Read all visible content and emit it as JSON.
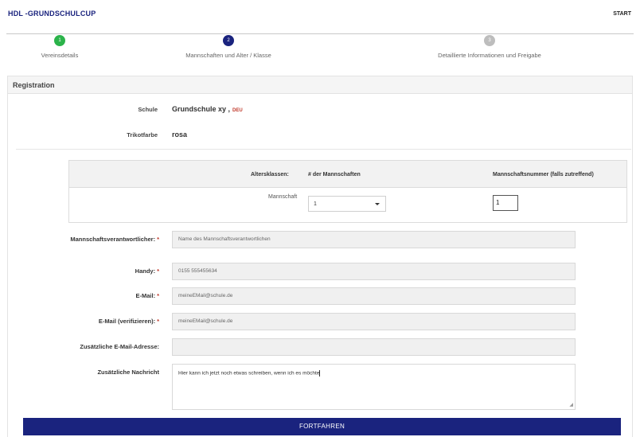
{
  "header": {
    "brand": "HDL -GRUNDSCHULCUP",
    "start_link": "START"
  },
  "stepper": {
    "steps": [
      {
        "number": "1",
        "label": "Vereinsdetails",
        "state": "done",
        "color": "#2bb34a"
      },
      {
        "number": "2",
        "label": "Mannschaften und Alter / Klasse",
        "state": "active",
        "color": "#1a237e"
      },
      {
        "number": "3",
        "label": "Detaillierte Informationen und Freigabe",
        "state": "pending",
        "color": "#bdbdbd"
      }
    ]
  },
  "panel": {
    "title": "Registration"
  },
  "summary": {
    "school_label": "Schule",
    "school_value": "Grundschule xy ,",
    "school_country": "DEU",
    "jersey_label": "Trikotfarbe",
    "jersey_value": "rosa"
  },
  "age_table": {
    "headers": {
      "age_classes": "Altersklassen:",
      "team_count": "# der Mannschaften",
      "team_number": "Mannschaftsnummer (falls zutreffend)"
    },
    "row": {
      "label": "Mannschaft",
      "team_count_value": "1",
      "team_number_value": "1"
    }
  },
  "form": {
    "responsible": {
      "label": "Mannschaftsverantwortlicher:",
      "required": "*",
      "placeholder": "Name des Mannschaftsverantwortlichen"
    },
    "phone": {
      "label": "Handy:",
      "required": "*",
      "value": "0155 555455634"
    },
    "email": {
      "label": "E-Mail:",
      "required": "*",
      "value": "meineEMail@schule.de"
    },
    "email_verify": {
      "label": "E-Mail (verifizieren):",
      "required": "*",
      "value": "meineEMail@schule.de"
    },
    "extra_email": {
      "label": "Zusätzliche E-Mail-Adresse:",
      "value": ""
    },
    "message": {
      "label": "Zusätzliche Nachricht",
      "value": "Hier kann ich jetzt noch etwas schreiben, wenn ich es möchte"
    }
  },
  "actions": {
    "submit_label": "FORTFAHREN"
  },
  "colors": {
    "brand": "#1a237e",
    "required": "#c0392b",
    "step_done": "#2bb34a",
    "step_pending": "#bdbdbd"
  }
}
